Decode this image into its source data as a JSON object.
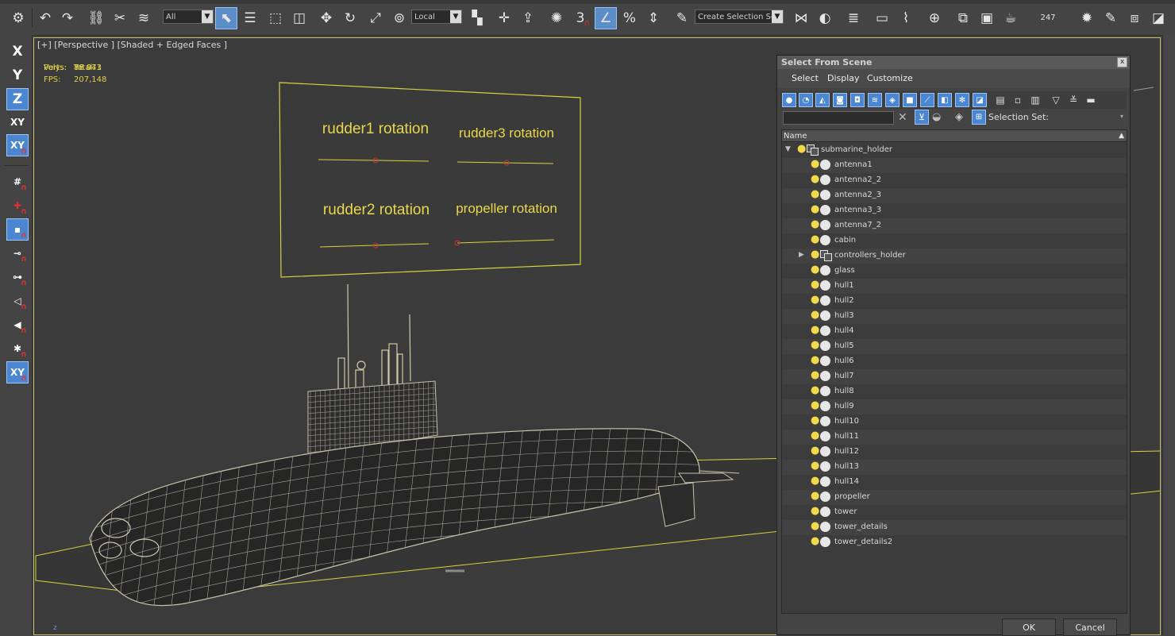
{
  "toolbar": {
    "filter_dropdown": "All",
    "coord_dropdown": "Local",
    "snap_value": "3",
    "selection_set_dropdown": "Create Selection Se",
    "counter": "247",
    "icons": [
      "undo-icon",
      "redo-icon",
      "link-icon",
      "unlink-icon",
      "bind-spacewarp-icon",
      "select-object-icon",
      "select-by-name-icon",
      "rect-region-icon",
      "window-crossing-icon",
      "move-icon",
      "rotate-icon",
      "scale-icon",
      "pivot-icon",
      "keyboard-shortcut-icon",
      "snap-toggle-icon",
      "angle-snap-icon",
      "percent-snap-icon",
      "spinner-snap-icon",
      "edit-named-sets-icon",
      "mirror-icon",
      "align-icon",
      "layer-explorer-icon",
      "ribbon-icon",
      "curve-editor-icon",
      "schematic-view-icon",
      "material-editor-icon",
      "render-setup-icon",
      "rendered-frame-icon",
      "render-icon",
      "settings-icon",
      "light-icon",
      "compare-icon"
    ]
  },
  "left_toolbar": {
    "x_label": "X",
    "y_label": "Y",
    "z_label": "Z",
    "xy_label": "XY",
    "xy_snap_label": "XY"
  },
  "viewport": {
    "label": "[+] [Perspective ] [Shaded + Edged Faces ]",
    "stats": {
      "total_label": "Total",
      "polys_label": "Polys:",
      "polys_value": "78 043",
      "verts_label": "Verts:",
      "verts_value": "86 971",
      "fps_label": "FPS:",
      "fps_value": "207,148"
    },
    "panel_labels": {
      "rudder1": "rudder1 rotation",
      "rudder3": "rudder3 rotation",
      "rudder2": "rudder2 rotation",
      "propeller": "propeller rotation"
    },
    "axis_label": "z"
  },
  "dialog": {
    "title": "Select From Scene",
    "close": "x",
    "menu": {
      "select": "Select",
      "display": "Display",
      "customize": "Customize"
    },
    "search_value": "",
    "selection_set_label": "Selection Set:",
    "column_header": "Name",
    "items": [
      {
        "name": "submarine_holder",
        "type": "group",
        "expanded": true,
        "level": 0
      },
      {
        "name": "antenna1",
        "type": "object",
        "level": 1
      },
      {
        "name": "antenna2_2",
        "type": "object",
        "level": 1
      },
      {
        "name": "antenna2_3",
        "type": "object",
        "level": 1
      },
      {
        "name": "antenna3_3",
        "type": "object",
        "level": 1
      },
      {
        "name": "antenna7_2",
        "type": "object",
        "level": 1
      },
      {
        "name": "cabin",
        "type": "object",
        "level": 1
      },
      {
        "name": "controllers_holder",
        "type": "group",
        "expanded": false,
        "level": 1
      },
      {
        "name": "glass",
        "type": "object",
        "level": 1
      },
      {
        "name": "hull1",
        "type": "object",
        "level": 1
      },
      {
        "name": "hull2",
        "type": "object",
        "level": 1
      },
      {
        "name": "hull3",
        "type": "object",
        "level": 1
      },
      {
        "name": "hull4",
        "type": "object",
        "level": 1
      },
      {
        "name": "hull5",
        "type": "object",
        "level": 1
      },
      {
        "name": "hull6",
        "type": "object",
        "level": 1
      },
      {
        "name": "hull7",
        "type": "object",
        "level": 1
      },
      {
        "name": "hull8",
        "type": "object",
        "level": 1
      },
      {
        "name": "hull9",
        "type": "object",
        "level": 1
      },
      {
        "name": "hull10",
        "type": "object",
        "level": 1
      },
      {
        "name": "hull11",
        "type": "object",
        "level": 1
      },
      {
        "name": "hull12",
        "type": "object",
        "level": 1
      },
      {
        "name": "hull13",
        "type": "object",
        "level": 1
      },
      {
        "name": "hull14",
        "type": "object",
        "level": 1
      },
      {
        "name": "propeller",
        "type": "object",
        "level": 1
      },
      {
        "name": "tower",
        "type": "object",
        "level": 1
      },
      {
        "name": "tower_details",
        "type": "object",
        "level": 1
      },
      {
        "name": "tower_details2",
        "type": "object",
        "level": 1
      }
    ],
    "ok_label": "OK",
    "cancel_label": "Cancel"
  },
  "colors": {
    "accent": "#4a86d1",
    "viewport_text": "#e0d24a",
    "bulb": "#f2d94a",
    "wire": "#d8d0a0"
  }
}
